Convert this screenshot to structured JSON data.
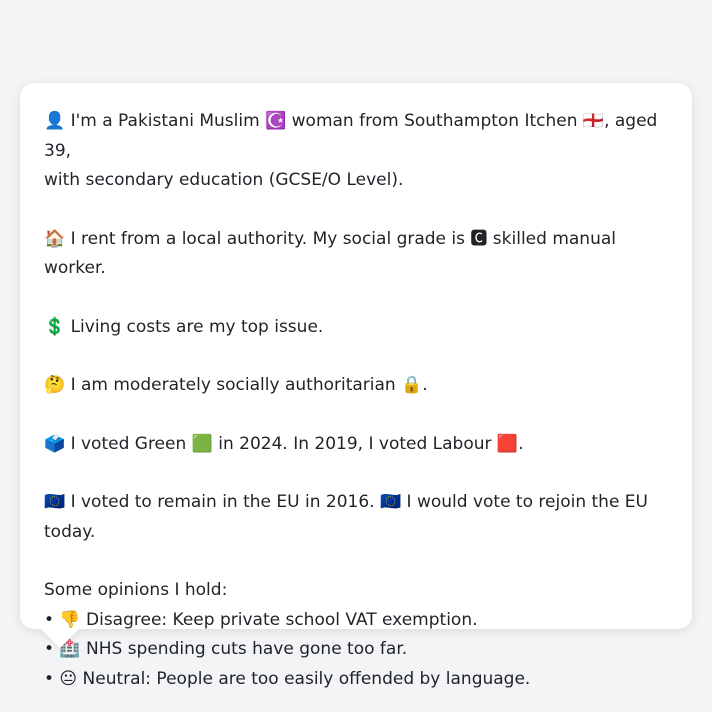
{
  "bio": {
    "identity_line1": "👤 I'm a Pakistani Muslim ☪️ woman from Southampton Itchen 🏴󠁧󠁢󠁥󠁮󠁧󠁿, aged 39,",
    "identity_line2": "with secondary education (GCSE/O Level).",
    "housing": "🏠 I rent from a local authority. My social grade is 🅲 skilled manual worker.",
    "issue": "💲 Living costs are my top issue.",
    "values": "🤔 I am moderately socially authoritarian 🔒.",
    "vote": "🗳️ I voted Green 🟩 in 2024. In 2019, I voted Labour 🟥.",
    "eu": "🇪🇺 I voted to remain in the EU in 2016. 🇪🇺 I would vote to rejoin the EU today."
  },
  "opinions": {
    "heading": "Some opinions I hold:",
    "items": [
      "• 👎 Disagree: Keep private school VAT exemption.",
      "• 🏥 NHS spending cuts have gone too far.",
      "• 😐 Neutral: People are too easily offended by language."
    ]
  }
}
